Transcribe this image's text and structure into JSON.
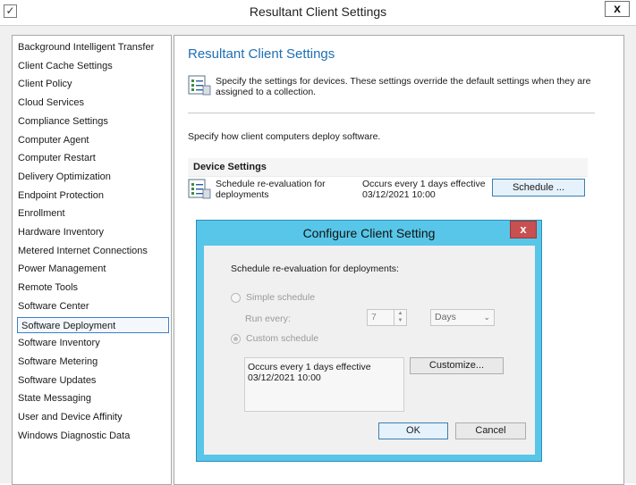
{
  "window": {
    "title": "Resultant Client Settings",
    "close_label": "x",
    "check_glyph": "✓"
  },
  "nav": {
    "items": [
      "Background Intelligent Transfer",
      "Client Cache Settings",
      "Client Policy",
      "Cloud Services",
      "Compliance Settings",
      "Computer Agent",
      "Computer Restart",
      "Delivery Optimization",
      "Endpoint Protection",
      "Enrollment",
      "Hardware Inventory",
      "Metered Internet Connections",
      "Power Management",
      "Remote Tools",
      "Software Center",
      "Software Deployment",
      "Software Inventory",
      "Software Metering",
      "Software Updates",
      "State Messaging",
      "User and Device Affinity",
      "Windows Diagnostic Data"
    ],
    "selected": "Software Deployment"
  },
  "content": {
    "title": "Resultant Client Settings",
    "description": "Specify the settings for devices. These settings override the default settings when they are assigned to a collection.",
    "deploy_text": "Specify how client computers deploy software.",
    "section_header": "Device Settings",
    "setting": {
      "name": "Schedule re-evaluation for deployments",
      "value": "Occurs every 1 days effective 03/12/2021 10:00",
      "button": "Schedule ..."
    }
  },
  "dialog": {
    "title": "Configure Client Setting",
    "close_label": "x",
    "heading": "Schedule re-evaluation for deployments:",
    "simple_schedule": "Simple schedule",
    "run_every": "Run every:",
    "run_every_value": "7",
    "unit": "Days",
    "custom_schedule": "Custom schedule",
    "schedule_summary": "Occurs every 1 days effective 03/12/2021 10:00",
    "customize_button": "Customize...",
    "ok_button": "OK",
    "cancel_button": "Cancel"
  },
  "colors": {
    "accent_title": "#1e6fb4",
    "dialog_frame": "#58c6e8",
    "dialog_close": "#c75050",
    "selection_border": "#3f7fc8"
  }
}
